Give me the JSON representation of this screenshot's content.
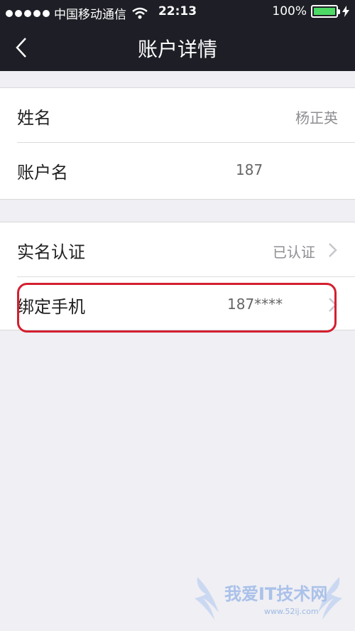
{
  "status_bar": {
    "carrier": "中国移动通信",
    "time": "22:13",
    "battery": "100%"
  },
  "nav": {
    "title": "账户详情"
  },
  "group1": [
    {
      "label": "姓名",
      "value": "杨正英"
    },
    {
      "label": "账户名",
      "value": "187"
    }
  ],
  "group2": [
    {
      "label": "实名认证",
      "value": "已认证"
    },
    {
      "label": "绑定手机",
      "value": "187****"
    }
  ],
  "watermark": {
    "text": "我爱IT技术网",
    "url": "www.52ij.com"
  }
}
